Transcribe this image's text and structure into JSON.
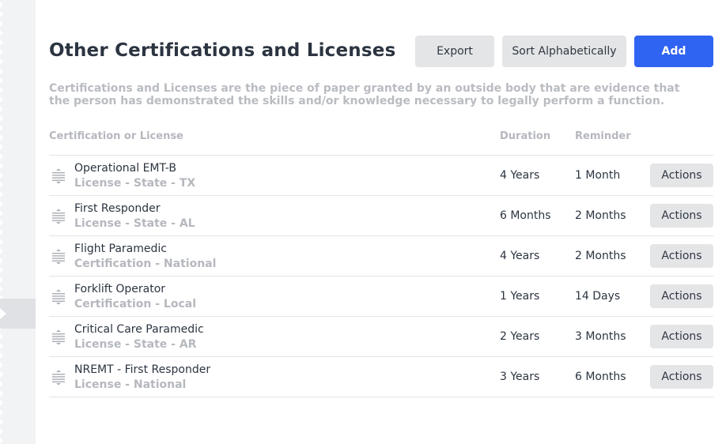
{
  "header": {
    "title": "Other Certifications and Licenses",
    "export_label": "Export",
    "sort_label": "Sort Alphabetically",
    "add_label": "Add"
  },
  "description": "Certifications and Licenses are the piece of paper granted by an outside body that are evidence that the person has demonstrated the skills and/or knowledge necessary to legally perform a function.",
  "table": {
    "columns": {
      "name": "Certification or License",
      "duration": "Duration",
      "reminder": "Reminder"
    },
    "actions_label": "Actions",
    "rows": [
      {
        "name": "Operational EMT-B",
        "subtitle": "License - State - TX",
        "duration": "4 Years",
        "reminder": "1 Month"
      },
      {
        "name": "First Responder",
        "subtitle": "License - State - AL",
        "duration": "6 Months",
        "reminder": "2 Months"
      },
      {
        "name": "Flight Paramedic",
        "subtitle": "Certification - National",
        "duration": "4 Years",
        "reminder": "2 Months"
      },
      {
        "name": "Forklift Operator",
        "subtitle": "Certification - Local",
        "duration": "1 Years",
        "reminder": "14 Days"
      },
      {
        "name": "Critical Care Paramedic",
        "subtitle": "License - State - AR",
        "duration": "2 Years",
        "reminder": "3 Months"
      },
      {
        "name": "NREMT - First Responder",
        "subtitle": "License - National",
        "duration": "3 Years",
        "reminder": "6 Months"
      }
    ]
  },
  "icons": {
    "drag": "drag-handle-icon"
  },
  "colors": {
    "primary": "#2f63f2",
    "button_grey": "#e4e5e7",
    "muted_text": "#b5b8bd"
  }
}
